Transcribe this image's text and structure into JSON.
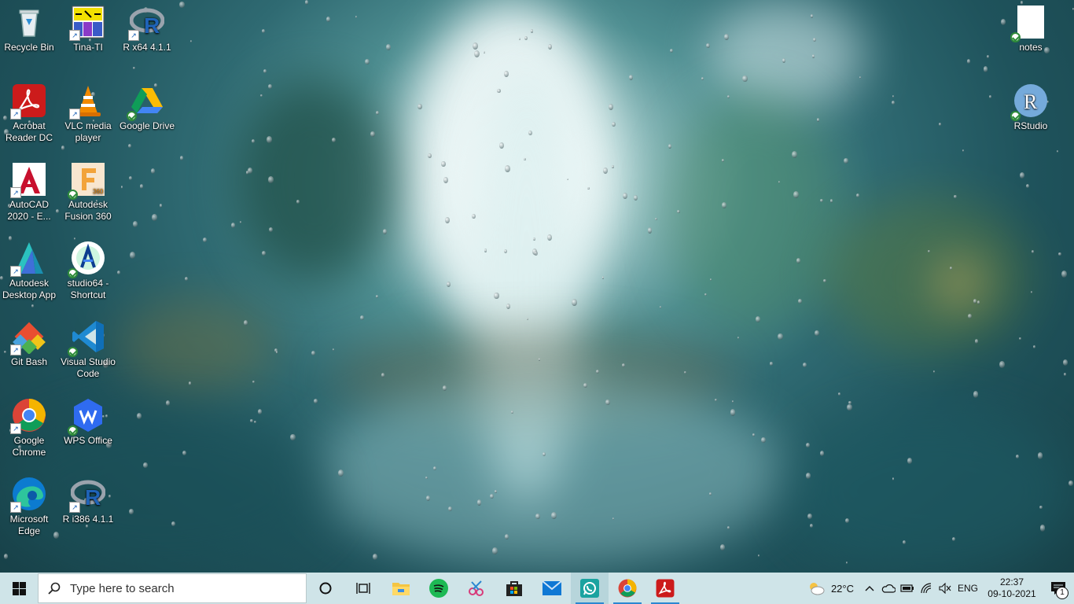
{
  "desktop": {
    "icons": [
      {
        "label": "Recycle Bin"
      },
      {
        "label": "Tina-TI"
      },
      {
        "label": "R x64 4.1.1"
      },
      {
        "label": "notes"
      },
      {
        "label": "Acrobat Reader DC"
      },
      {
        "label": "VLC media player"
      },
      {
        "label": "Google Drive"
      },
      {
        "label": "RStudio"
      },
      {
        "label": "AutoCAD 2020 - E..."
      },
      {
        "label": "Autodesk Fusion 360"
      },
      {
        "label": "Autodesk Desktop App"
      },
      {
        "label": "studio64 - Shortcut"
      },
      {
        "label": "Git Bash"
      },
      {
        "label": "Visual Studio Code"
      },
      {
        "label": "Google Chrome"
      },
      {
        "label": "WPS Office"
      },
      {
        "label": "Microsoft Edge"
      },
      {
        "label": "R i386 4.1.1"
      }
    ]
  },
  "taskbar": {
    "search_placeholder": "Type here to search",
    "pinned": [
      "start-icon",
      "search-icon",
      "cortana-icon",
      "task-view-icon",
      "file-explorer-icon",
      "spotify-icon",
      "snip-icon",
      "store-icon",
      "mail-icon",
      "whatsapp-icon",
      "chrome-icon",
      "acrobat-icon"
    ],
    "weather_temp": "22°C",
    "language": "ENG",
    "time": "22:37",
    "date": "09-10-2021",
    "notification_count": "1"
  },
  "colors": {
    "taskbar_bg": "#cfe4e8",
    "accent": "#2b87d1"
  }
}
